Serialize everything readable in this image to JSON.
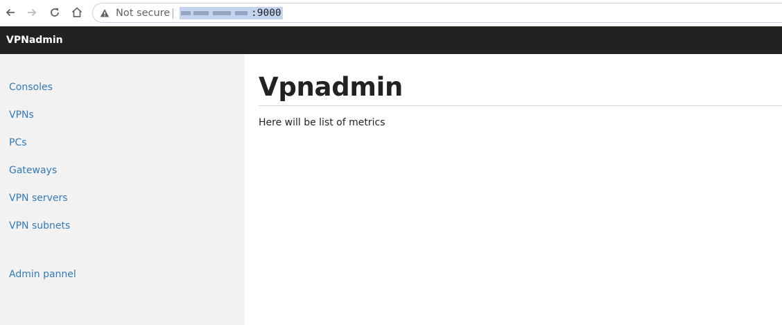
{
  "browser": {
    "security_label": "Not secure",
    "url_port": ":9000"
  },
  "app": {
    "brand": "VPNadmin"
  },
  "sidebar": {
    "items": [
      {
        "label": "Consoles"
      },
      {
        "label": "VPNs"
      },
      {
        "label": "PCs"
      },
      {
        "label": "Gateways"
      },
      {
        "label": "VPN servers"
      },
      {
        "label": "VPN subnets"
      },
      {
        "label": "Admin pannel"
      }
    ]
  },
  "main": {
    "title": "Vpnadmin",
    "body": "Here will be list of metrics"
  },
  "colors": {
    "navbar": "#222222",
    "link": "#337ab7",
    "sidebar_bg": "#f2f2f2"
  }
}
